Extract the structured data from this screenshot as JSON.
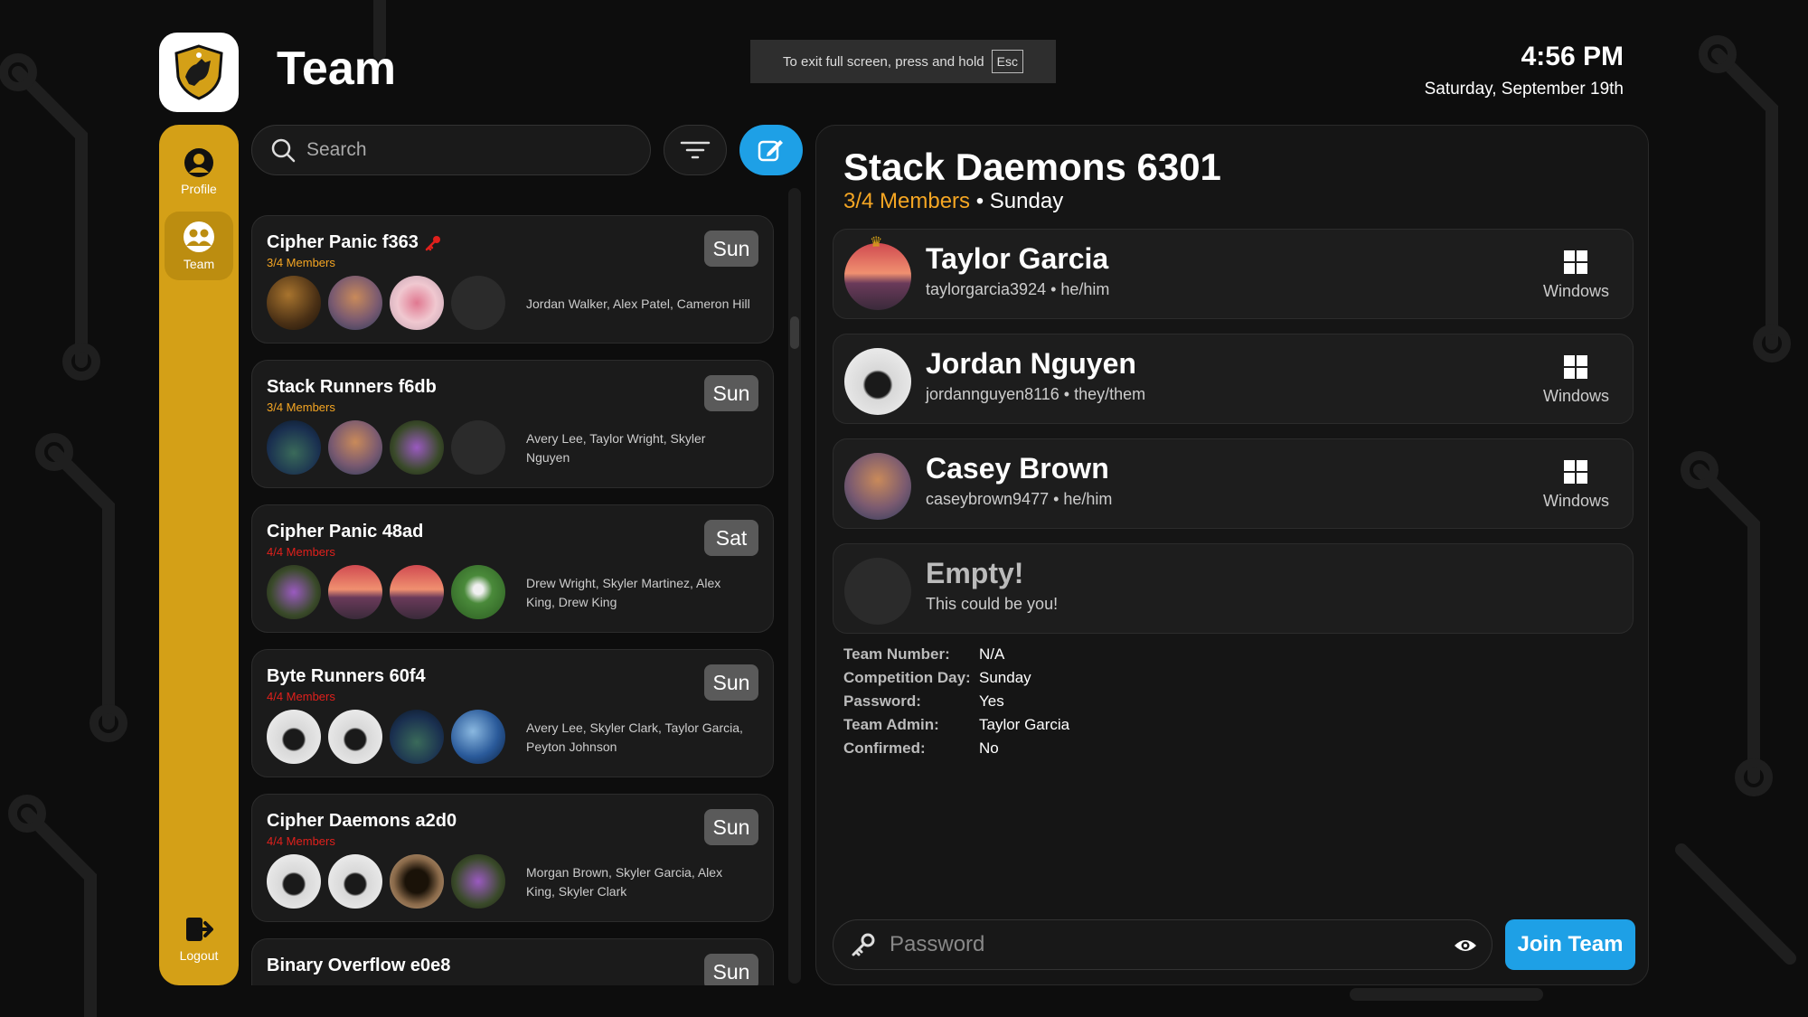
{
  "header": {
    "title": "Team"
  },
  "fullscreen_notice": {
    "text": "To exit full screen, press and hold",
    "key": "Esc"
  },
  "clock": {
    "time": "4:56 PM",
    "date": "Saturday, September 19th"
  },
  "sidebar": {
    "items": [
      {
        "label": "Profile",
        "icon": "profile-icon"
      },
      {
        "label": "Team",
        "icon": "team-icon",
        "active": true
      },
      {
        "label": "Logout",
        "icon": "logout-icon"
      }
    ]
  },
  "search": {
    "placeholder": "Search"
  },
  "teams": [
    {
      "name": "Cipher Panic f363",
      "locked": true,
      "members": "3/4 Members",
      "members_color": "#f5a623",
      "day": "Sun",
      "member_names": "Jordan Walker, Alex Patel, Cameron Hill",
      "avatars": [
        "horse",
        "tree",
        "flower",
        "empty"
      ]
    },
    {
      "name": "Stack Runners f6db",
      "members": "3/4 Members",
      "members_color": "#f5a623",
      "day": "Sun",
      "member_names": "Avery Lee, Taylor Wright, Skyler Nguyen",
      "avatars": [
        "gate",
        "tree",
        "purple",
        "empty"
      ]
    },
    {
      "name": "Cipher Panic 48ad",
      "members": "4/4 Members",
      "members_color": "#e0201c",
      "day": "Sat",
      "member_names": "Drew Wright, Skyler Martinez, Alex King, Drew King",
      "avatars": [
        "purple",
        "sunset",
        "sunset",
        "person"
      ]
    },
    {
      "name": "Byte Runners 60f4",
      "members": "4/4 Members",
      "members_color": "#e0201c",
      "day": "Sun",
      "member_names": "Avery Lee, Skyler Clark, Taylor Garcia, Peyton Johnson",
      "avatars": [
        "sketch",
        "sketch",
        "gate",
        "blue"
      ]
    },
    {
      "name": "Cipher Daemons a2d0",
      "members": "4/4 Members",
      "members_color": "#e0201c",
      "day": "Sun",
      "member_names": "Morgan Brown, Skyler Garcia, Alex King, Skyler Clark",
      "avatars": [
        "sketch",
        "sketch",
        "horse",
        "purple"
      ]
    },
    {
      "name": "Binary Overflow e0e8",
      "members": "",
      "members_color": "#e0201c",
      "day": "Sun",
      "member_names": "",
      "avatars": []
    }
  ],
  "detail": {
    "title": "Stack Daemons 6301",
    "members_text": "3/4 Members",
    "members_color": "#f5a623",
    "day_text": " • Sunday",
    "members": [
      {
        "name": "Taylor Garcia",
        "sub": "taylorgarcia3924 • he/him",
        "os": "Windows",
        "admin": true,
        "avatar": "sunset"
      },
      {
        "name": "Jordan Nguyen",
        "sub": "jordannguyen8116 • they/them",
        "os": "Windows",
        "avatar": "sketch"
      },
      {
        "name": "Casey Brown",
        "sub": "caseybrown9477 • he/him",
        "os": "Windows",
        "avatar": "tree"
      }
    ],
    "empty": {
      "title": "Empty!",
      "text": "This could be you!"
    },
    "info": [
      {
        "label": "Team Number:",
        "value": "N/A"
      },
      {
        "label": "Competition Day:",
        "value": "Sunday"
      },
      {
        "label": "Password:",
        "value": "Yes"
      },
      {
        "label": "Team Admin:",
        "value": "Taylor Garcia"
      },
      {
        "label": "Confirmed:",
        "value": "No"
      }
    ],
    "password_placeholder": "Password",
    "join_label": "Join Team"
  },
  "colors": {
    "accent": "#d4a017",
    "primary": "#1ea0e6",
    "warning": "#f5a623",
    "full": "#e0201c"
  }
}
